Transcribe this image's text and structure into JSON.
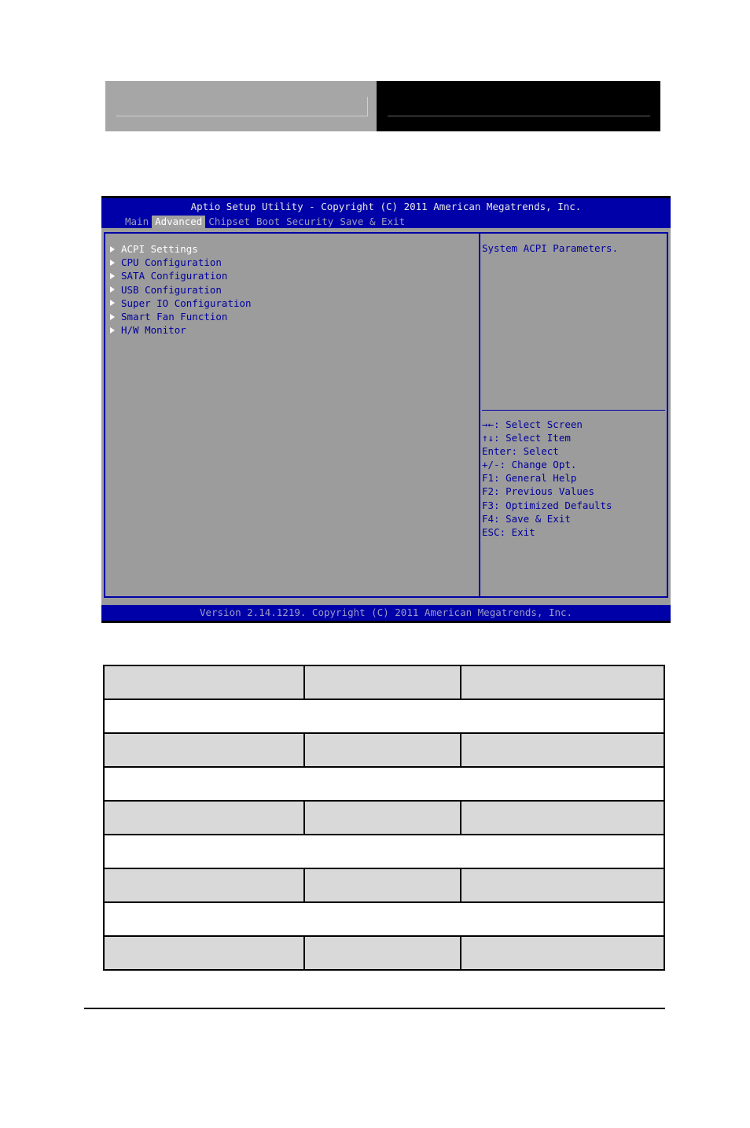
{
  "bios": {
    "title": "Aptio Setup Utility - Copyright (C) 2011 American Megatrends, Inc.",
    "tabs": [
      {
        "label": "Main",
        "active": false
      },
      {
        "label": "Advanced",
        "active": true
      },
      {
        "label": "Chipset",
        "active": false
      },
      {
        "label": "Boot",
        "active": false
      },
      {
        "label": "Security",
        "active": false
      },
      {
        "label": "Save & Exit",
        "active": false
      }
    ],
    "menu_items": [
      {
        "label": "ACPI Settings",
        "selected": true,
        "icon": "submenu-arrow-icon"
      },
      {
        "label": "CPU Configuration",
        "selected": false,
        "icon": "submenu-arrow-icon"
      },
      {
        "label": "SATA Configuration",
        "selected": false,
        "icon": "submenu-arrow-icon"
      },
      {
        "label": "USB Configuration",
        "selected": false,
        "icon": "submenu-arrow-icon"
      },
      {
        "label": "Super IO Configuration",
        "selected": false,
        "icon": "submenu-arrow-icon"
      },
      {
        "label": "Smart Fan Function",
        "selected": false,
        "icon": "submenu-arrow-icon"
      },
      {
        "label": "H/W Monitor",
        "selected": false,
        "icon": "submenu-arrow-icon"
      }
    ],
    "help_text": "System ACPI Parameters.",
    "key_help": [
      "→←: Select Screen",
      "↑↓: Select Item",
      "Enter: Select",
      "+/-: Change Opt.",
      "F1: General Help",
      "F2: Previous Values",
      "F3: Optimized Defaults",
      "F4: Save & Exit",
      "ESC: Exit"
    ],
    "footer": "Version 2.14.1219. Copyright (C) 2011 American Megatrends, Inc.",
    "colors": {
      "bar_blue": "#0000a8",
      "body_gray": "#9c9c9c",
      "text_blue": "#00009c",
      "highlight_white": "#ffffff"
    }
  },
  "table": {
    "rows": [
      {
        "type": "shaded",
        "cells": [
          "",
          "",
          ""
        ]
      },
      {
        "type": "blank",
        "cells": [
          ""
        ]
      },
      {
        "type": "shaded",
        "cells": [
          "",
          "",
          ""
        ]
      },
      {
        "type": "blank",
        "cells": [
          ""
        ]
      },
      {
        "type": "shaded",
        "cells": [
          "",
          "",
          ""
        ]
      },
      {
        "type": "blank",
        "cells": [
          ""
        ]
      },
      {
        "type": "shaded",
        "cells": [
          "",
          "",
          ""
        ]
      },
      {
        "type": "blank",
        "cells": [
          ""
        ]
      },
      {
        "type": "shaded",
        "cells": [
          "",
          "",
          ""
        ]
      }
    ]
  }
}
